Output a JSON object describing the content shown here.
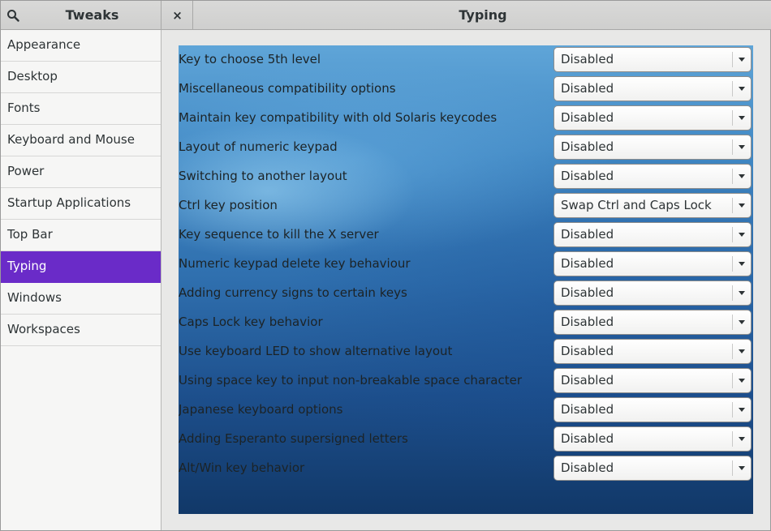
{
  "app": {
    "title": "Tweaks",
    "page_title": "Typing",
    "close_label": "×"
  },
  "sidebar": {
    "items": [
      {
        "label": "Appearance"
      },
      {
        "label": "Desktop"
      },
      {
        "label": "Fonts"
      },
      {
        "label": "Keyboard and Mouse"
      },
      {
        "label": "Power"
      },
      {
        "label": "Startup Applications"
      },
      {
        "label": "Top Bar"
      },
      {
        "label": "Typing",
        "active": true
      },
      {
        "label": "Windows"
      },
      {
        "label": "Workspaces"
      }
    ]
  },
  "settings": [
    {
      "label": "Key to choose 5th level",
      "value": "Disabled"
    },
    {
      "label": "Miscellaneous compatibility options",
      "value": "Disabled"
    },
    {
      "label": "Maintain key compatibility with old Solaris keycodes",
      "value": "Disabled"
    },
    {
      "label": "Layout of numeric keypad",
      "value": "Disabled"
    },
    {
      "label": "Switching to another layout",
      "value": "Disabled"
    },
    {
      "label": "Ctrl key position",
      "value": "Swap Ctrl and Caps Lock"
    },
    {
      "label": "Key sequence to kill the X server",
      "value": "Disabled"
    },
    {
      "label": "Numeric keypad delete key behaviour",
      "value": "Disabled"
    },
    {
      "label": "Adding currency signs to certain keys",
      "value": "Disabled"
    },
    {
      "label": "Caps Lock key behavior",
      "value": "Disabled"
    },
    {
      "label": "Use keyboard LED to show alternative layout",
      "value": "Disabled"
    },
    {
      "label": "Using space key to input non-breakable space character",
      "value": "Disabled"
    },
    {
      "label": "Japanese keyboard options",
      "value": "Disabled"
    },
    {
      "label": "Adding Esperanto supersigned letters",
      "value": "Disabled"
    },
    {
      "label": "Alt/Win key behavior",
      "value": "Disabled"
    }
  ],
  "colors": {
    "accent": "#6a2bc8",
    "sidebar_bg": "#f6f6f5",
    "header_bg": "#d4d4d3"
  },
  "icons": {
    "search": "search-icon",
    "close": "close-icon",
    "dropdown": "chevron-down-icon"
  }
}
